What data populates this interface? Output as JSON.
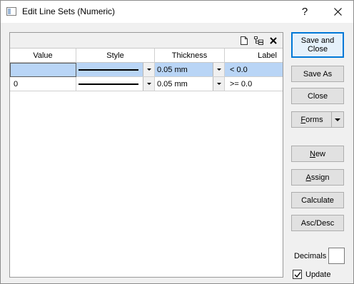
{
  "window": {
    "title": "Edit Line Sets (Numeric)",
    "help_glyph": "?"
  },
  "grid": {
    "toolbar_icons": [
      "new-document-icon",
      "tree-view-icon",
      "delete-icon"
    ],
    "columns": {
      "value": "Value",
      "style": "Style",
      "thickness": "Thickness",
      "label": "Label"
    },
    "rows": [
      {
        "value": "",
        "thickness": "0.05 mm",
        "label": "< 0.0",
        "selected": true
      },
      {
        "value": "0",
        "thickness": "0.05 mm",
        "label": ">= 0.0",
        "selected": false
      }
    ]
  },
  "buttons": {
    "save_close": "Save and Close",
    "save_as": "Save As",
    "close": "Close",
    "forms": "Forms",
    "new": "New",
    "assign": "Assign",
    "calculate": "Calculate",
    "asc_desc": "Asc/Desc"
  },
  "options": {
    "decimals_label": "Decimals",
    "decimals_value": "",
    "update_label": "Update",
    "update_checked": true
  },
  "colors": {
    "accent": "#0078d7",
    "selection": "#b9d5f6"
  }
}
